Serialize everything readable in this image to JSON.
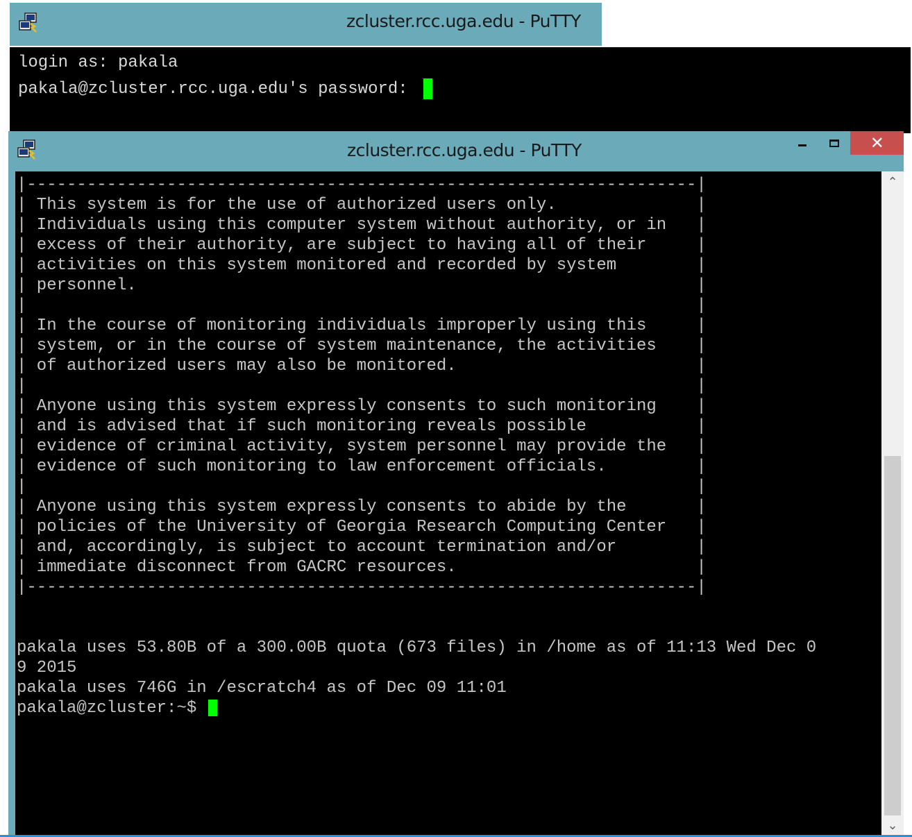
{
  "window_back": {
    "title": "zcluster.rcc.uga.edu - PuTTY",
    "lines": [
      "login as: pakala",
      "pakala@zcluster.rcc.uga.edu's password: "
    ]
  },
  "window_front": {
    "title": "zcluster.rcc.uga.edu - PuTTY",
    "close_glyph": "✕",
    "scroll_up_glyph": "⌃",
    "scroll_down_glyph": "⌄",
    "banner": [
      "|-------------------------------------------------------------------|",
      "| This system is for the use of authorized users only.              |",
      "| Individuals using this computer system without authority, or in   |",
      "| excess of their authority, are subject to having all of their     |",
      "| activities on this system monitored and recorded by system        |",
      "| personnel.                                                        |",
      "|                                                                   |",
      "| In the course of monitoring individuals improperly using this     |",
      "| system, or in the course of system maintenance, the activities    |",
      "| of authorized users may also be monitored.                        |",
      "|                                                                   |",
      "| Anyone using this system expressly consents to such monitoring    |",
      "| and is advised that if such monitoring reveals possible           |",
      "| evidence of criminal activity, system personnel may provide the   |",
      "| evidence of such monitoring to law enforcement officials.         |",
      "|                                                                   |",
      "| Anyone using this system expressly consents to abide by the       |",
      "| policies of the University of Georgia Research Computing Center   |",
      "| and, accordingly, is subject to account termination and/or        |",
      "| immediate disconnect from GACRC resources.                        |",
      "|-------------------------------------------------------------------|"
    ],
    "output": [
      "",
      "",
      "pakala uses 53.80B of a 300.00B quota (673 files) in /home as of 11:13 Wed Dec 0",
      "9 2015",
      "pakala uses 746G in /escratch4 as of Dec 09 11:01"
    ],
    "prompt": "pakala@zcluster:~$ "
  },
  "colors": {
    "titlebar": "#6aaab9",
    "terminal_bg": "#000000",
    "terminal_fg": "#c6c6c6",
    "cursor": "#00ff00",
    "close_button": "#c7504f"
  }
}
